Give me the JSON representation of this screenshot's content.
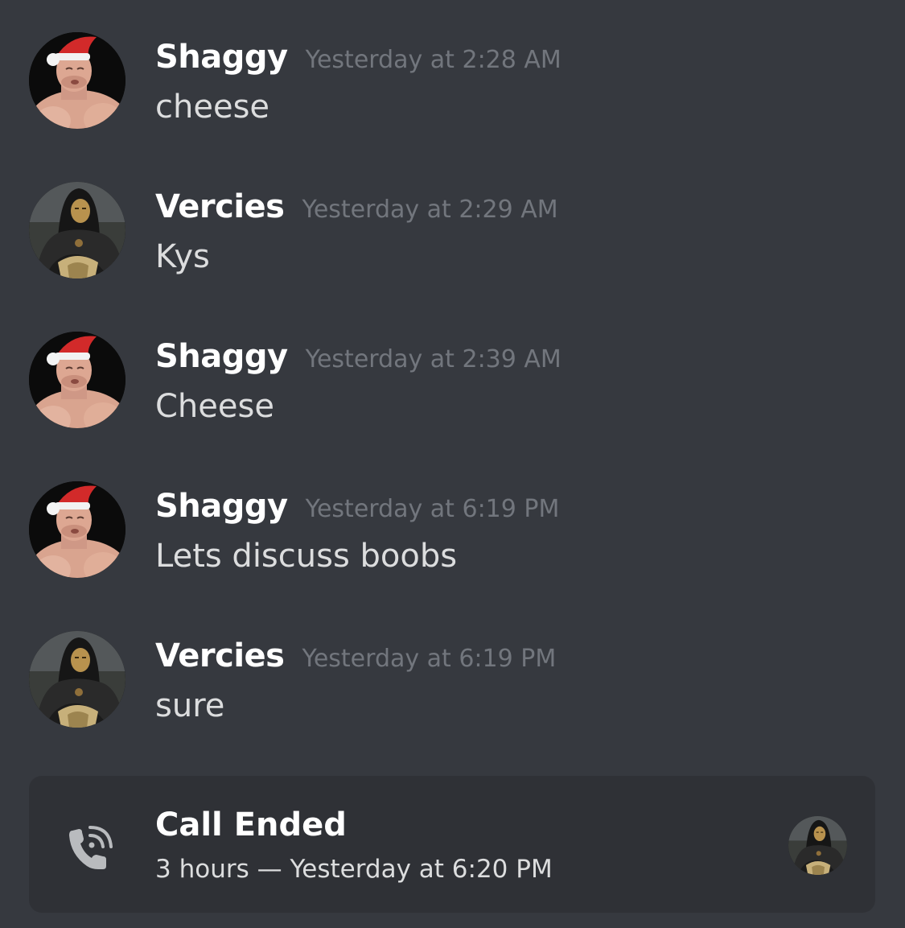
{
  "messages": [
    {
      "author": "Shaggy",
      "timestamp": "Yesterday at 2:28 AM",
      "content": "cheese",
      "avatar_icon": "shaggy-avatar"
    },
    {
      "author": "Vercies",
      "timestamp": "Yesterday at 2:29 AM",
      "content": "Kys",
      "avatar_icon": "vercies-avatar"
    },
    {
      "author": "Shaggy",
      "timestamp": "Yesterday at 2:39 AM",
      "content": "Cheese",
      "avatar_icon": "shaggy-avatar"
    },
    {
      "author": "Shaggy",
      "timestamp": "Yesterday at 6:19 PM",
      "content": "Lets discuss boobs",
      "avatar_icon": "shaggy-avatar"
    },
    {
      "author": "Vercies",
      "timestamp": "Yesterday at 6:19 PM",
      "content": "sure",
      "avatar_icon": "vercies-avatar"
    }
  ],
  "call": {
    "title": "Call Ended",
    "detail": "3 hours — Yesterday at 6:20 PM",
    "icon": "phone-call-ended-icon",
    "participant_icon": "vercies-avatar"
  },
  "colors": {
    "background": "#36393f",
    "card": "#2f3136",
    "author": "#ffffff",
    "timestamp": "#72767d",
    "text": "#dcddde"
  }
}
